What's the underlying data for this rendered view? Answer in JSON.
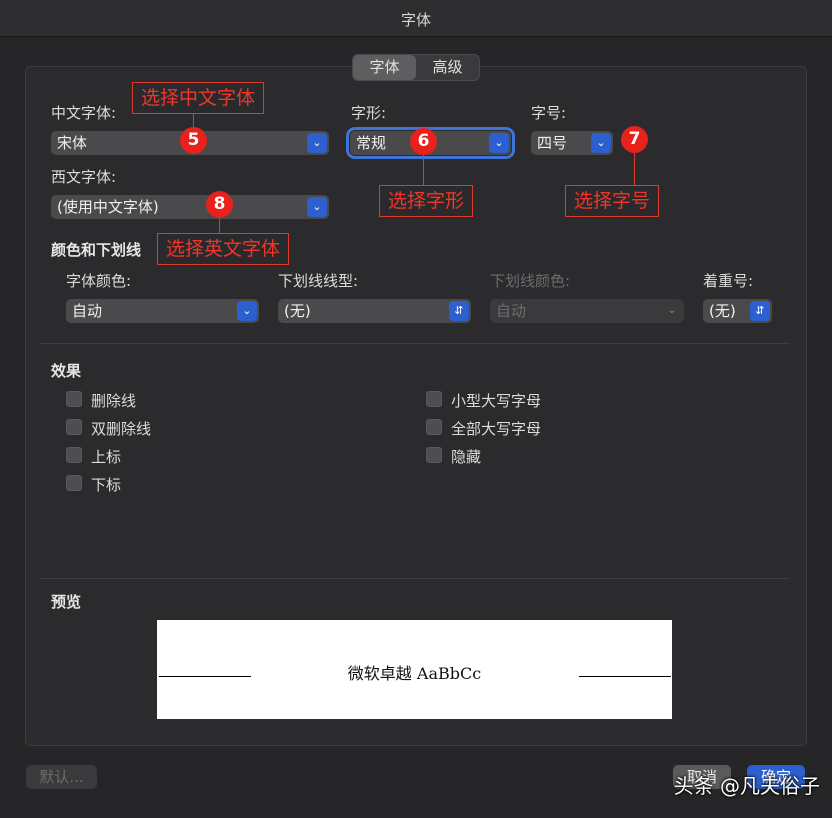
{
  "window": {
    "title": "字体"
  },
  "tabs": [
    {
      "label": "字体",
      "active": true
    },
    {
      "label": "高级",
      "active": false
    }
  ],
  "chinese_font": {
    "label": "中文字体:",
    "value": "宋体"
  },
  "style": {
    "label": "字形:",
    "value": "常规"
  },
  "size": {
    "label": "字号:",
    "value": "四号"
  },
  "western_font": {
    "label": "西文字体:",
    "value": "(使用中文字体)"
  },
  "color_underline": {
    "heading": "颜色和下划线",
    "font_color": {
      "label": "字体颜色:",
      "value": "自动"
    },
    "underline_style": {
      "label": "下划线线型:",
      "value": "(无)"
    },
    "underline_color": {
      "label": "下划线颜色:",
      "value": "自动"
    },
    "emphasis": {
      "label": "着重号:",
      "value": "(无)"
    }
  },
  "effects": {
    "heading": "效果",
    "left": [
      "删除线",
      "双删除线",
      "上标",
      "下标"
    ],
    "right": [
      "小型大写字母",
      "全部大写字母",
      "隐藏"
    ]
  },
  "preview": {
    "heading": "预览",
    "sample": "微软卓越  AaBbCc"
  },
  "footer": {
    "default_label": "默认...",
    "cancel_label": "取消",
    "ok_label": "确定"
  },
  "annotations": {
    "a5": {
      "text": "选择中文字体",
      "num": "5"
    },
    "a6": {
      "text": "选择字形",
      "num": "6"
    },
    "a7": {
      "text": "选择字号",
      "num": "7"
    },
    "a8": {
      "text": "选择英文字体",
      "num": "8"
    }
  },
  "watermark": "头条 @凡夫俗子",
  "colors": {
    "accent": "#2d5fcf",
    "annotation_red": "#e8211c"
  }
}
